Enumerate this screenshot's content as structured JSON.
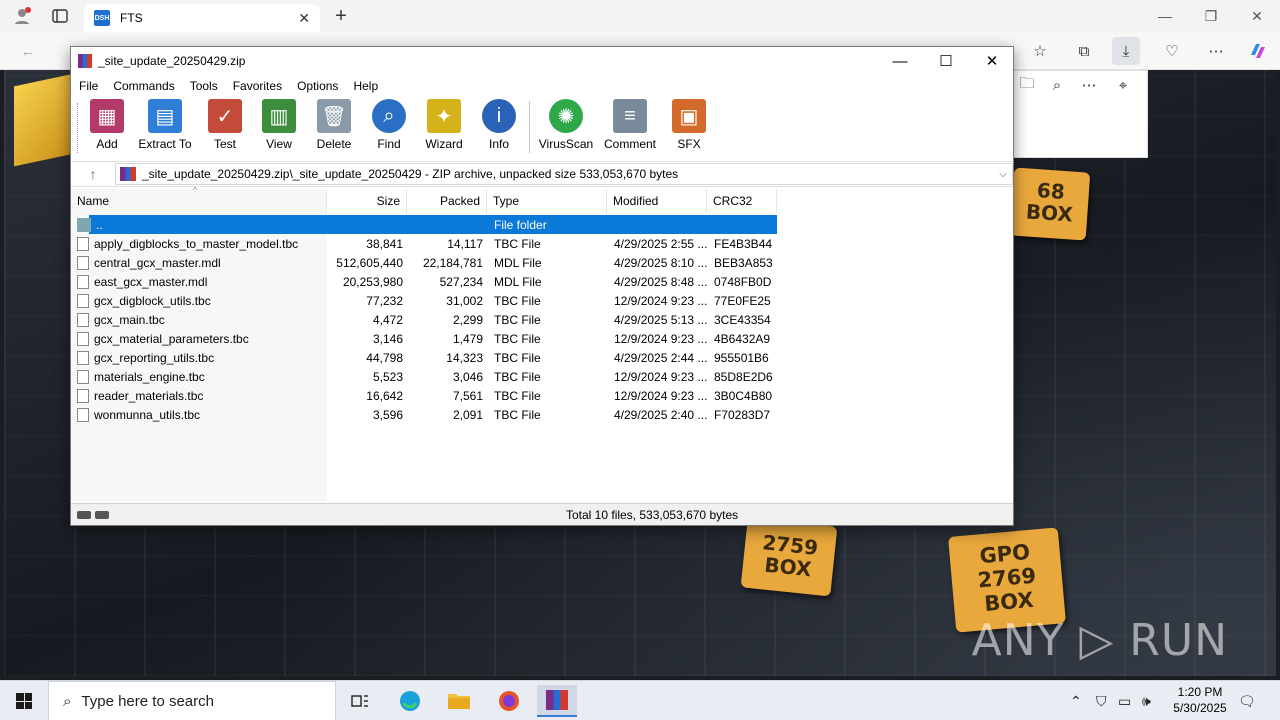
{
  "browser": {
    "tab_title": "FTS",
    "tab_favicon_text": "DSH",
    "close_tab": "✕",
    "new_tab": "+"
  },
  "watermark": "ANY ▷ RUN",
  "plaques": [
    {
      "text": "68\nBOX"
    },
    {
      "text": "2759\nBOX"
    },
    {
      "text": "GPO\n2769\nBOX"
    }
  ],
  "winrar": {
    "title": "_site_update_20250429.zip",
    "menu": [
      "File",
      "Commands",
      "Tools",
      "Favorites",
      "Options",
      "Help"
    ],
    "toolbar": [
      {
        "label": "Add",
        "icon": "add-icon",
        "color": "#b33a6a"
      },
      {
        "label": "Extract To",
        "icon": "extract-icon",
        "color": "#2f7fd8"
      },
      {
        "label": "Test",
        "icon": "test-icon",
        "color": "#c44a3a"
      },
      {
        "label": "View",
        "icon": "view-icon",
        "color": "#3c8d3c"
      },
      {
        "label": "Delete",
        "icon": "delete-icon",
        "color": "#8a9aa8"
      },
      {
        "label": "Find",
        "icon": "find-icon",
        "color": "#2a6fc4"
      },
      {
        "label": "Wizard",
        "icon": "wizard-icon",
        "color": "#d4b21a"
      },
      {
        "label": "Info",
        "icon": "info-icon",
        "color": "#2a62b8"
      },
      {
        "label": "VirusScan",
        "icon": "virusscan-icon",
        "color": "#2fa84a"
      },
      {
        "label": "Comment",
        "icon": "comment-icon",
        "color": "#7a8a9a"
      },
      {
        "label": "SFX",
        "icon": "sfx-icon",
        "color": "#d46a2a"
      }
    ],
    "path": "_site_update_20250429.zip\\_site_update_20250429 - ZIP archive, unpacked size 533,053,670 bytes",
    "columns": [
      "Name",
      "Size",
      "Packed",
      "Type",
      "Modified",
      "CRC32"
    ],
    "parent_row": {
      "name": "..",
      "type": "File folder"
    },
    "files": [
      {
        "name": "apply_digblocks_to_master_model.tbc",
        "size": "38,841",
        "packed": "14,117",
        "type": "TBC File",
        "modified": "4/29/2025 2:55 ...",
        "crc": "FE4B3B44"
      },
      {
        "name": "central_gcx_master.mdl",
        "size": "512,605,440",
        "packed": "22,184,781",
        "type": "MDL File",
        "modified": "4/29/2025 8:10 ...",
        "crc": "BEB3A853"
      },
      {
        "name": "east_gcx_master.mdl",
        "size": "20,253,980",
        "packed": "527,234",
        "type": "MDL File",
        "modified": "4/29/2025 8:48 ...",
        "crc": "0748FB0D"
      },
      {
        "name": "gcx_digblock_utils.tbc",
        "size": "77,232",
        "packed": "31,002",
        "type": "TBC File",
        "modified": "12/9/2024 9:23 ...",
        "crc": "77E0FE25"
      },
      {
        "name": "gcx_main.tbc",
        "size": "4,472",
        "packed": "2,299",
        "type": "TBC File",
        "modified": "4/29/2025 5:13 ...",
        "crc": "3CE43354"
      },
      {
        "name": "gcx_material_parameters.tbc",
        "size": "3,146",
        "packed": "1,479",
        "type": "TBC File",
        "modified": "12/9/2024 9:23 ...",
        "crc": "4B6432A9"
      },
      {
        "name": "gcx_reporting_utils.tbc",
        "size": "44,798",
        "packed": "14,323",
        "type": "TBC File",
        "modified": "4/29/2025 2:44 ...",
        "crc": "955501B6"
      },
      {
        "name": "materials_engine.tbc",
        "size": "5,523",
        "packed": "3,046",
        "type": "TBC File",
        "modified": "12/9/2024 9:23 ...",
        "crc": "85D8E2D6"
      },
      {
        "name": "reader_materials.tbc",
        "size": "16,642",
        "packed": "7,561",
        "type": "TBC File",
        "modified": "12/9/2024 9:23 ...",
        "crc": "3B0C4B80"
      },
      {
        "name": "wonmunna_utils.tbc",
        "size": "3,596",
        "packed": "2,091",
        "type": "TBC File",
        "modified": "4/29/2025 2:40 ...",
        "crc": "F70283D7"
      }
    ],
    "status_total": "Total 10 files, 533,053,670 bytes"
  },
  "taskbar": {
    "search_placeholder": "Type here to search",
    "time": "1:20 PM",
    "date": "5/30/2025"
  }
}
